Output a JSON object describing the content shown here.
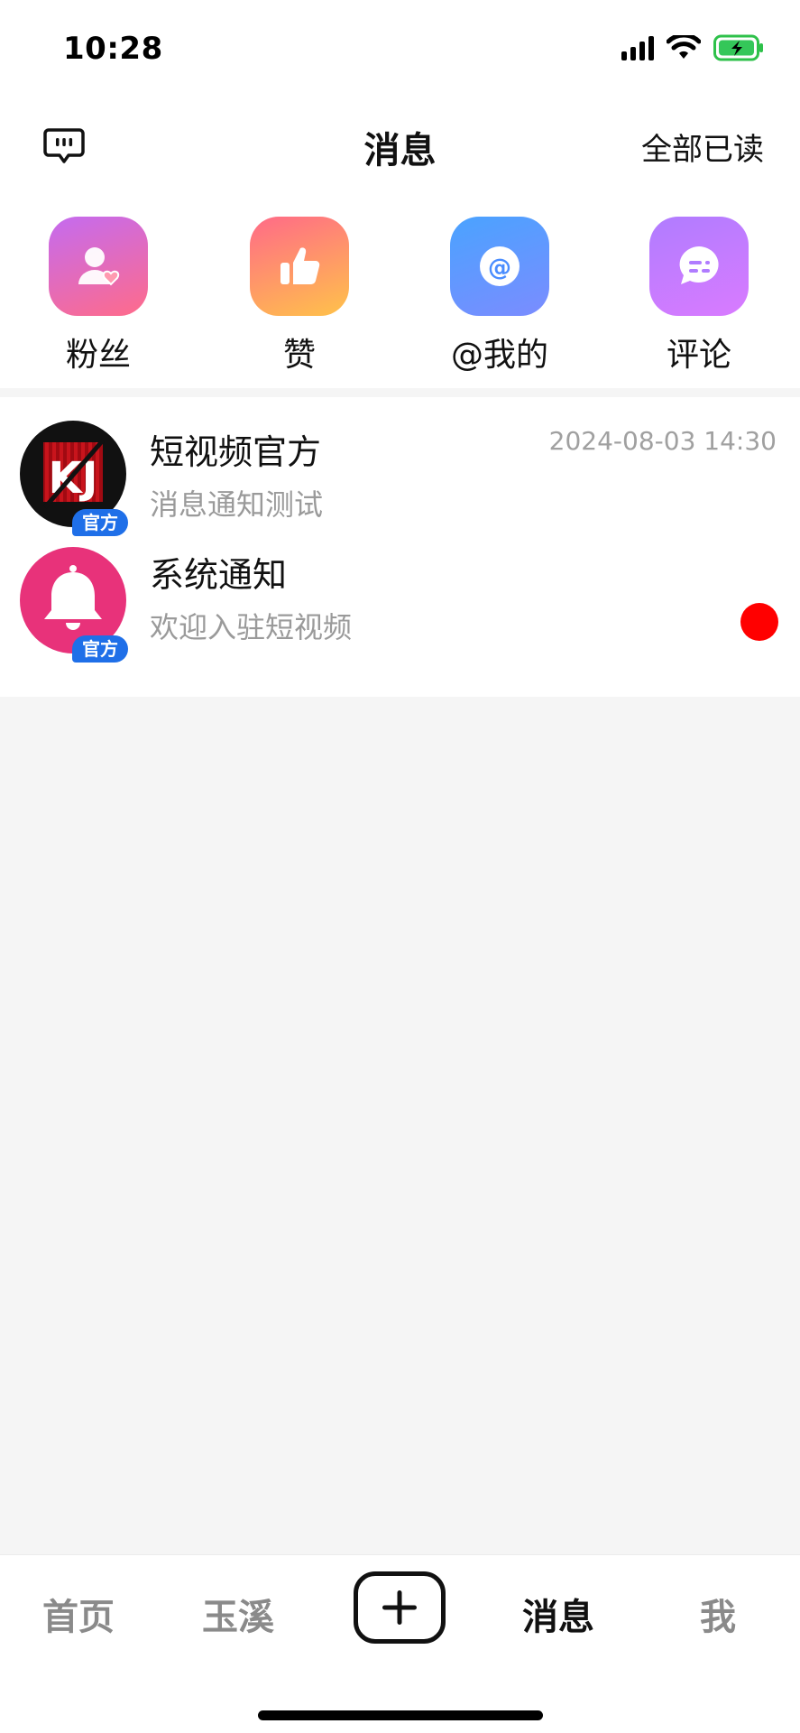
{
  "status_bar": {
    "time": "10:28"
  },
  "header": {
    "title": "消息",
    "mark_all_read": "全部已读"
  },
  "quick_entries": [
    {
      "label": "粉丝",
      "icon": "fans-icon",
      "color_from": "#c46bf0",
      "color_to": "#ff6b8a"
    },
    {
      "label": "赞",
      "icon": "thumbs-up-icon",
      "color_from": "#ff6a88",
      "color_to": "#ffc24a"
    },
    {
      "label": "@我的",
      "icon": "at-icon",
      "color_from": "#4aa3ff",
      "color_to": "#7b8cff"
    },
    {
      "label": "评论",
      "icon": "comment-icon",
      "color_from": "#b07cff",
      "color_to": "#d97bff"
    }
  ],
  "messages": [
    {
      "name": "短视频官方",
      "preview": "消息通知测试",
      "timestamp": "2024-08-03 14:30",
      "badge": "官方",
      "avatar_text": "KJ",
      "unread": false
    },
    {
      "name": "系统通知",
      "preview": "欢迎入驻短视频",
      "timestamp": "",
      "badge": "官方",
      "avatar_icon": "bell-icon",
      "unread": true
    }
  ],
  "tabbar": {
    "home": "首页",
    "yuxi": "玉溪",
    "messages": "消息",
    "me": "我",
    "active": "消息"
  },
  "colors": {
    "official_badge": "#1f6fe8",
    "unread_dot": "#ff0000",
    "bell_avatar": "#e8327a"
  }
}
